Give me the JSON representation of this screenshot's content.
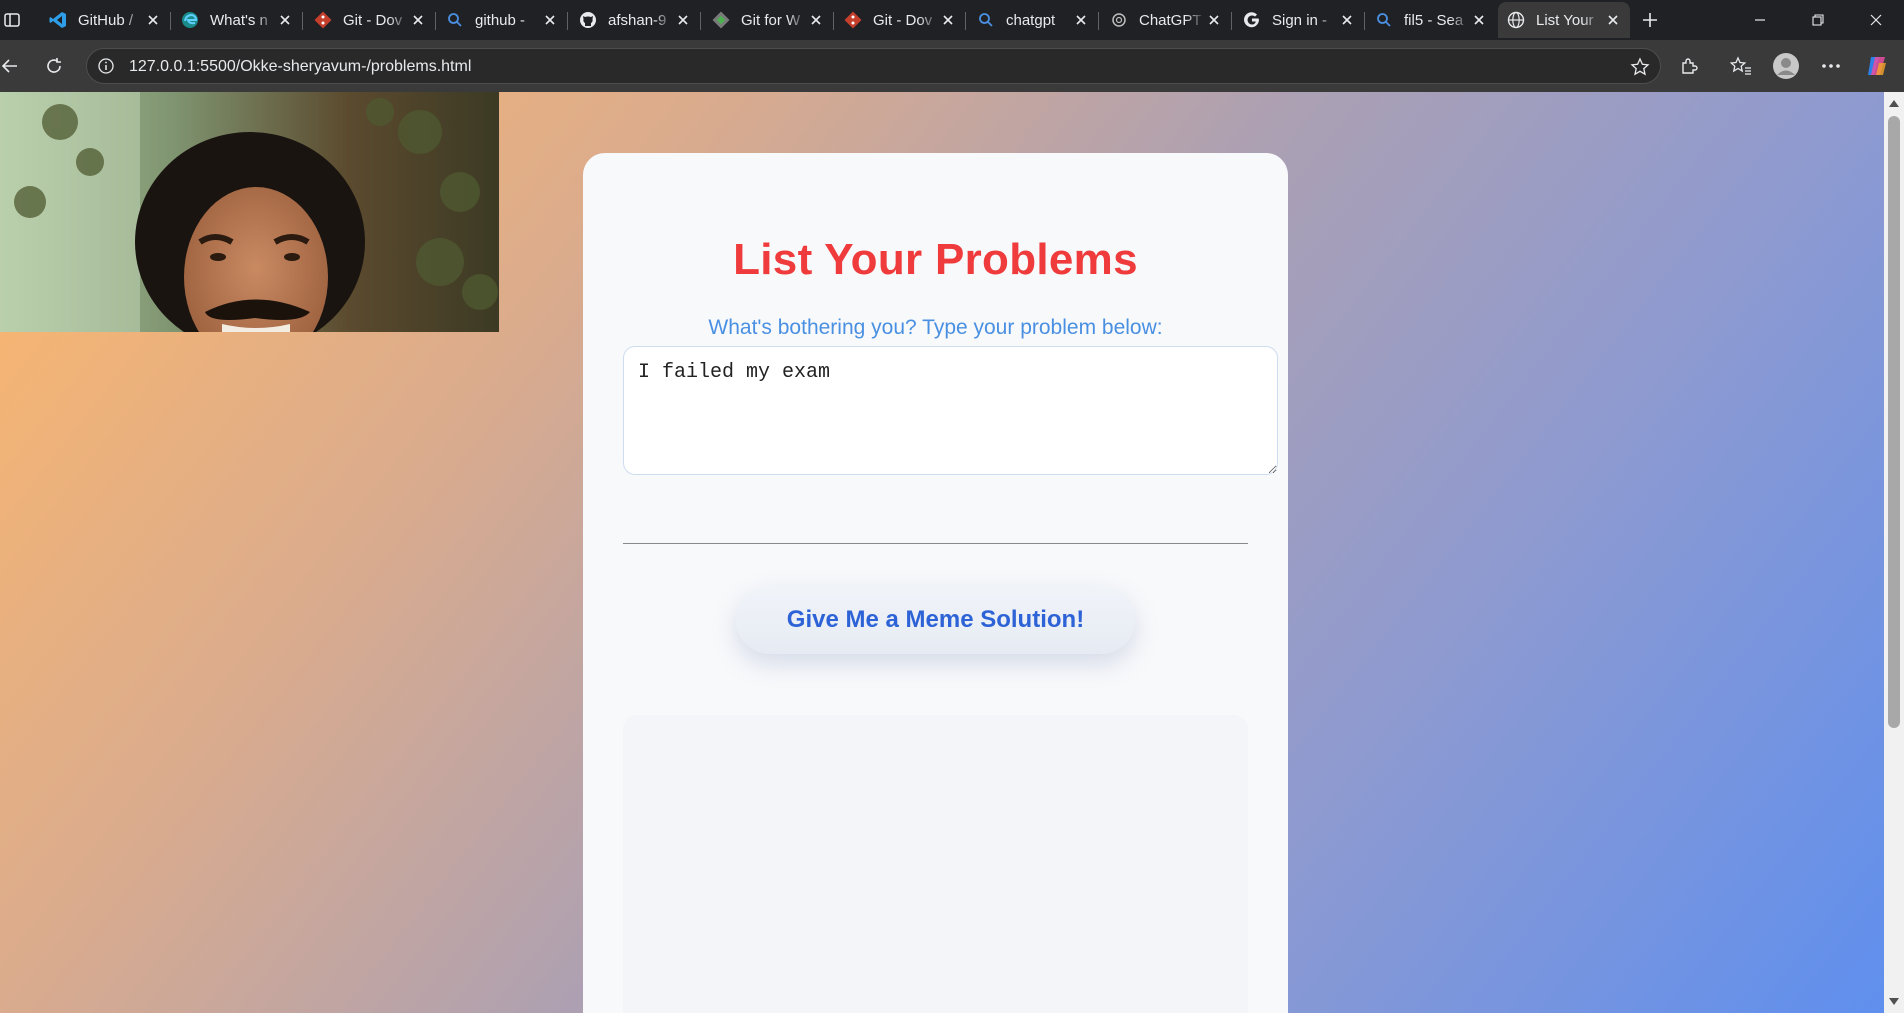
{
  "browser": {
    "tabs": [
      {
        "title": "GitHub /",
        "icon": "vscode-icon",
        "active": false
      },
      {
        "title": "What's n",
        "icon": "edge-icon",
        "active": false
      },
      {
        "title": "Git - Dov",
        "icon": "git-icon",
        "active": false
      },
      {
        "title": "github -",
        "icon": "search-icon",
        "active": false
      },
      {
        "title": "afshan-9",
        "icon": "github-icon",
        "active": false
      },
      {
        "title": "Git for W",
        "icon": "git-for-windows-icon",
        "active": false
      },
      {
        "title": "Git - Dov",
        "icon": "git-icon",
        "active": false
      },
      {
        "title": "chatgpt",
        "icon": "search-icon",
        "active": false
      },
      {
        "title": "ChatGPT",
        "icon": "chatgpt-icon",
        "active": false
      },
      {
        "title": "Sign in -",
        "icon": "google-icon",
        "active": false
      },
      {
        "title": "fil5 - Sea",
        "icon": "search-icon",
        "active": false
      },
      {
        "title": "List Your",
        "icon": "globe-icon",
        "active": true
      }
    ],
    "url": "127.0.0.1:5500/Okke-sheryavum-/problems.html"
  },
  "page": {
    "heading": "List Your Problems",
    "prompt": "What's bothering you? Type your problem below:",
    "problem_text": "I failed my exam",
    "button_label": "Give Me a Meme Solution!"
  },
  "colors": {
    "heading": "#ef3b3b",
    "prompt": "#4a90e2",
    "button_text": "#2d63d6",
    "gradient_start": "#ffb86a",
    "gradient_end": "#5f8fee"
  }
}
